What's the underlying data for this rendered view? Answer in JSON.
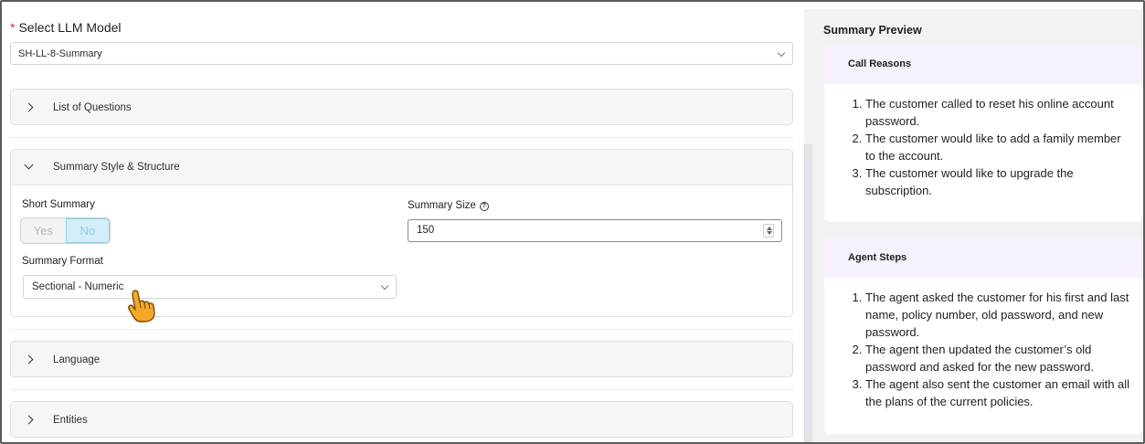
{
  "model": {
    "required_mark": "*",
    "label": "Select LLM Model",
    "selected": "SH-LL-8-Summary"
  },
  "sections": {
    "questions": "List of Questions",
    "style": "Summary Style & Structure",
    "language": "Language",
    "entities": "Entities"
  },
  "style_panel": {
    "short_summary_label": "Short Summary",
    "toggle_yes": "Yes",
    "toggle_no": "No",
    "toggle_selected": "No",
    "size_label": "Summary Size",
    "size_value": "150",
    "format_label": "Summary Format",
    "format_selected": "Sectional - Numeric"
  },
  "preview": {
    "title": "Summary Preview",
    "call_reasons": {
      "heading": "Call Reasons",
      "items": [
        "The customer called to reset his online account password.",
        "The customer would like to add a family member to the account.",
        "The customer would like to upgrade the subscription."
      ]
    },
    "agent_steps": {
      "heading": "Agent Steps",
      "items": [
        "The agent asked the customer for his first and last name, policy number, old password, and new password.",
        "The agent then updated the customer’s old password and asked for the new password.",
        "The agent also sent the customer an email with all the plans of the current policies."
      ]
    }
  },
  "colors": {
    "required": "#e0282e",
    "toggle_active_bg": "#d3eef6",
    "card_header_bg": "#f6f1fc",
    "cursor": "#f4a72a"
  },
  "icons": {
    "cursor": "pointing-hand-icon",
    "info": "info-icon"
  }
}
